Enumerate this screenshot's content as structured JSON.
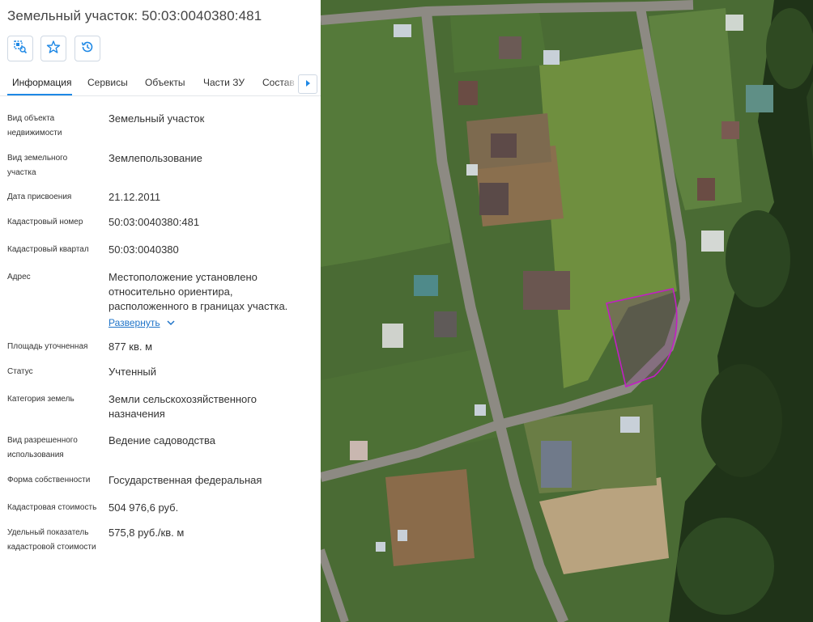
{
  "panel": {
    "title": "Земельный участок: 50:03:0040380:481",
    "toolbar": [
      {
        "name": "locate-on-map-button",
        "icon": "locate-icon"
      },
      {
        "name": "favorite-button",
        "icon": "star-icon"
      },
      {
        "name": "history-button",
        "icon": "history-icon"
      }
    ],
    "tabs": [
      "Информация",
      "Сервисы",
      "Объекты",
      "Части ЗУ",
      "Состав Е"
    ],
    "active_tab": "Информация",
    "fields": [
      {
        "label": "Вид объекта недвижимости",
        "value": "Земельный участок"
      },
      {
        "label": "Вид земельного участка",
        "value": "Землепользование"
      },
      {
        "label": "Дата присвоения",
        "value": "21.12.2011"
      },
      {
        "label": "Кадастровый номер",
        "value": "50:03:0040380:481"
      },
      {
        "label": "Кадастровый квартал",
        "value": "50:03:0040380"
      },
      {
        "label": "Адрес",
        "value": "Местоположение установлено относительно ориентира, расположенного в границах участка."
      },
      {
        "label": "Площадь уточненная",
        "value": "877 кв. м"
      },
      {
        "label": "Статус",
        "value": "Учтенный"
      },
      {
        "label": "Категория земель",
        "value": "Земли сельскохозяйственного назначения"
      },
      {
        "label": "Вид разрешенного использования",
        "value": "Ведение садоводства"
      },
      {
        "label": "Форма собственности",
        "value": "Государственная федеральная"
      },
      {
        "label": "Кадастровая стоимость",
        "value": "504 976,6 руб."
      },
      {
        "label": "Удельный показатель кадастровой стоимости",
        "value": "575,8 руб./кв. м"
      }
    ],
    "expand_label": "Развернуть"
  },
  "colors": {
    "accent": "#1e88e5",
    "link": "#1e73c8",
    "parcel_outline": "#c21fc4",
    "map_grass": "#4a6b34",
    "map_road": "#8d8a83",
    "map_forest": "#1f3318"
  },
  "map": {
    "highlighted_parcel": "50:03:0040380:481"
  }
}
